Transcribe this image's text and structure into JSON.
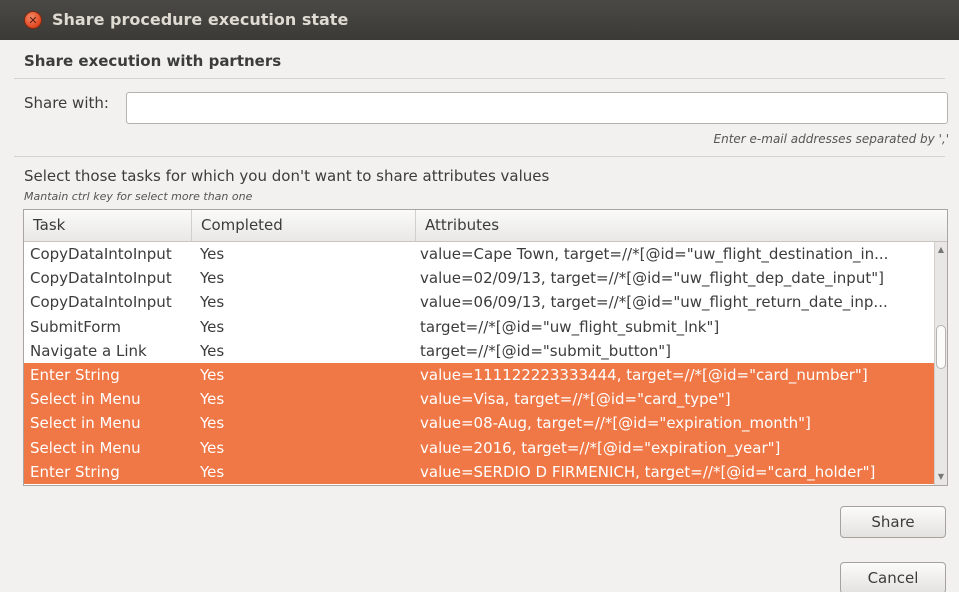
{
  "window": {
    "title": "Share procedure execution state"
  },
  "section": {
    "header": "Share execution with partners"
  },
  "share": {
    "label": "Share with:",
    "value": "",
    "hint": "Enter e-mail addresses separated by ','"
  },
  "tasks": {
    "title": "Select those tasks for which you don't want to share attributes values",
    "hint": "Mantain ctrl key for select more than one",
    "columns": [
      "Task",
      "Completed",
      "Attributes"
    ],
    "rows": [
      {
        "task": "CopyDataIntoInput",
        "completed": "Yes",
        "attributes": "value=Cape Town, target=//*[@id=\"uw_flight_destination_in...",
        "selected": false
      },
      {
        "task": "CopyDataIntoInput",
        "completed": "Yes",
        "attributes": "value=02/09/13, target=//*[@id=\"uw_flight_dep_date_input\"]",
        "selected": false
      },
      {
        "task": "CopyDataIntoInput",
        "completed": "Yes",
        "attributes": "value=06/09/13, target=//*[@id=\"uw_flight_return_date_inp...",
        "selected": false
      },
      {
        "task": "SubmitForm",
        "completed": "Yes",
        "attributes": "target=//*[@id=\"uw_flight_submit_lnk\"]",
        "selected": false
      },
      {
        "task": "Navigate a Link",
        "completed": "Yes",
        "attributes": "target=//*[@id=\"submit_button\"]",
        "selected": false
      },
      {
        "task": "Enter String",
        "completed": "Yes",
        "attributes": "value=111122223333444, target=//*[@id=\"card_number\"]",
        "selected": true
      },
      {
        "task": "Select in Menu",
        "completed": "Yes",
        "attributes": "value=Visa, target=//*[@id=\"card_type\"]",
        "selected": true
      },
      {
        "task": "Select in Menu",
        "completed": "Yes",
        "attributes": "value=08-Aug, target=//*[@id=\"expiration_month\"]",
        "selected": true
      },
      {
        "task": "Select in Menu",
        "completed": "Yes",
        "attributes": "value=2016, target=//*[@id=\"expiration_year\"]",
        "selected": true
      },
      {
        "task": "Enter String",
        "completed": "Yes",
        "attributes": "value=SERDIO D FIRMENICH, target=//*[@id=\"card_holder\"]",
        "selected": true
      }
    ],
    "scroll_position": 0.4
  },
  "buttons": {
    "share": "Share",
    "cancel": "Cancel"
  },
  "colors": {
    "selection": "#f07746",
    "titlebar": "#3c3b37"
  },
  "icons": {
    "close": "close-icon",
    "scroll_up": "chevron-up-icon",
    "scroll_down": "chevron-down-icon"
  }
}
